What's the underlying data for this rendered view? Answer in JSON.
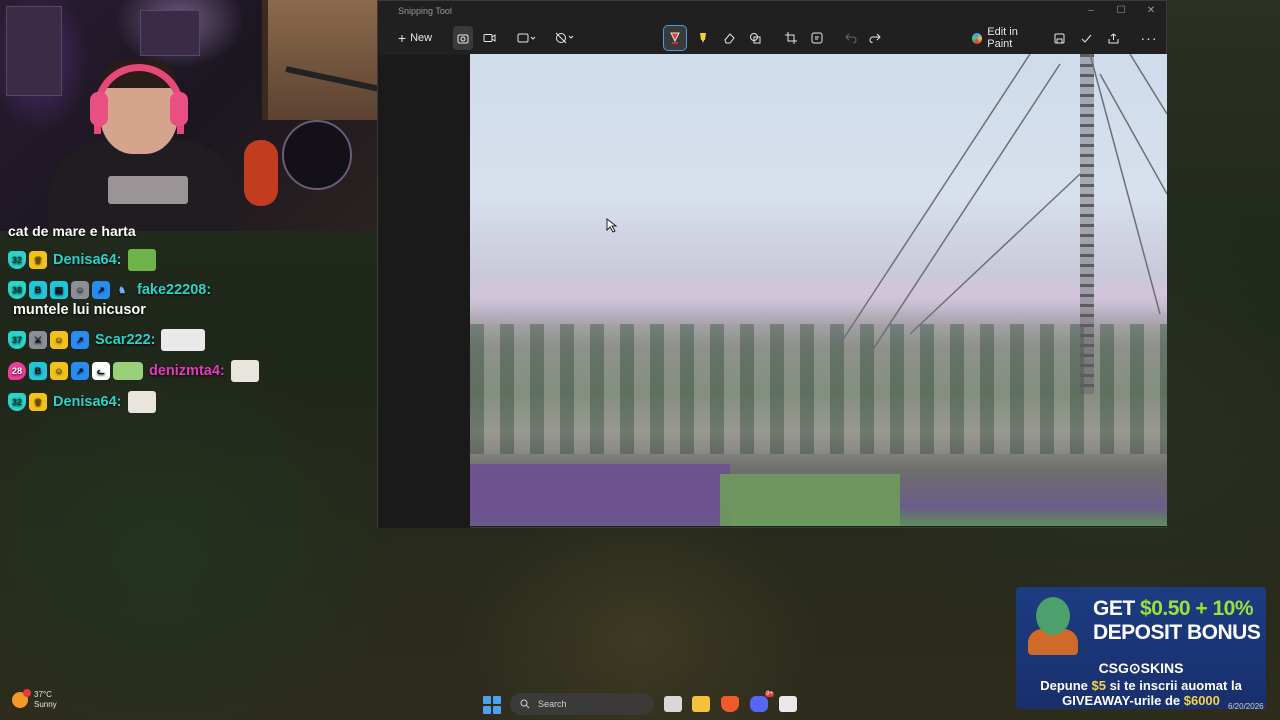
{
  "chat": {
    "top_text": "cat de mare e harta",
    "messages": [
      {
        "sub_months": "32",
        "username": "Denisa64:",
        "color": "#2bd4c9",
        "text": ""
      },
      {
        "sub_months": "38",
        "username": "fake22208:",
        "color": "#2bd4c9",
        "text": "muntele lui nicusor"
      },
      {
        "sub_months": "37",
        "username": "Scar222:",
        "color": "#2bd4c9",
        "text": ""
      },
      {
        "sub_months": "28",
        "username": "denizmta4:",
        "color": "#e23bbd",
        "text": ""
      },
      {
        "sub_months": "32",
        "username": "Denisa64:",
        "color": "#2bd4c9",
        "text": ""
      }
    ]
  },
  "snipping_tool": {
    "title": "Snipping Tool",
    "new_label": "New",
    "edit_in_paint_label": "Edit in Paint",
    "icons": [
      "camera-icon",
      "video-icon",
      "rectangle-mode-icon",
      "timer-off-icon",
      "pen-icon",
      "highlighter-icon",
      "eraser-icon",
      "shapes-icon",
      "crop-icon",
      "text-actions-icon",
      "undo-icon",
      "redo-icon",
      "paint-icon",
      "save-icon",
      "check-icon",
      "share-icon",
      "more-icon"
    ]
  },
  "taskbar": {
    "temperature": "37°C",
    "condition": "Sunny",
    "search_label": "Search",
    "date": "6/20/2026",
    "discord_badge": "9+"
  },
  "ad": {
    "headline_1a": "GET ",
    "headline_1b": "$0.50 + 10%",
    "headline_2": "DEPOSIT BONUS",
    "brand": "CSG⊙SKINS",
    "line1a": "Depune ",
    "line1b": "$5",
    "line1c": " si te inscrii auomat la",
    "line2a": "GIVEAWAY-urile de ",
    "line2b": "$6000"
  }
}
